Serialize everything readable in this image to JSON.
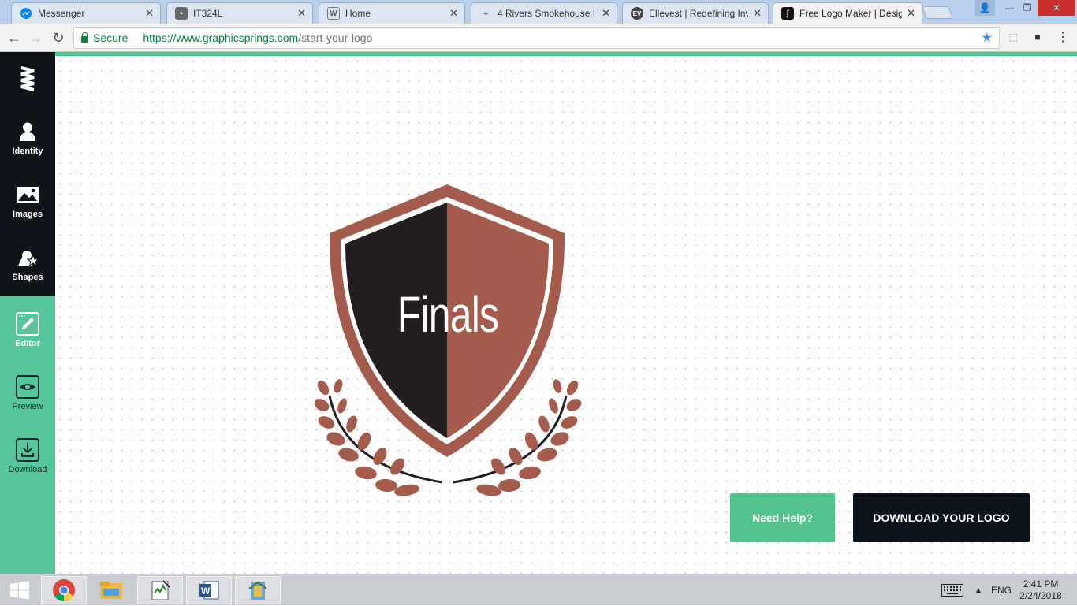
{
  "browser": {
    "tabs": [
      {
        "title": "Messenger",
        "favicon": "messenger-icon",
        "active": false
      },
      {
        "title": "IT324L",
        "favicon": "contact-card-icon",
        "active": false
      },
      {
        "title": "Home",
        "favicon": "wikipedia-w-icon",
        "active": false
      },
      {
        "title": "4 Rivers Smokehouse | Th",
        "favicon": "4rivers-icon",
        "active": false
      },
      {
        "title": "Ellevest | Redefining Inve",
        "favicon": "ellevest-icon",
        "active": false
      },
      {
        "title": "Free Logo Maker | Desig",
        "favicon": "graphicsprings-icon",
        "active": true
      }
    ],
    "secure_label": "Secure",
    "url_host": "https://www.graphicsprings.com",
    "url_path": "/start-your-logo"
  },
  "sidebar": {
    "items": [
      {
        "label": "Identity",
        "icon": "person-icon"
      },
      {
        "label": "Images",
        "icon": "image-icon"
      },
      {
        "label": "Shapes",
        "icon": "shapes-icon"
      },
      {
        "label": "Editor",
        "icon": "edit-icon"
      },
      {
        "label": "Preview",
        "icon": "eye-icon"
      },
      {
        "label": "Download",
        "icon": "download-icon"
      }
    ]
  },
  "logo": {
    "text": "Finals",
    "colors": {
      "dark": "#231f20",
      "accent": "#a55b4c",
      "outline": "#ffffff"
    }
  },
  "actions": {
    "help_label": "Need Help?",
    "download_label": "DOWNLOAD YOUR LOGO"
  },
  "taskbar": {
    "language": "ENG",
    "time": "2:41 PM",
    "date": "2/24/2018"
  },
  "colors": {
    "brand_green": "#56c69a",
    "sidebar_dark": "#0e141a",
    "button_dark": "#0c131a"
  }
}
